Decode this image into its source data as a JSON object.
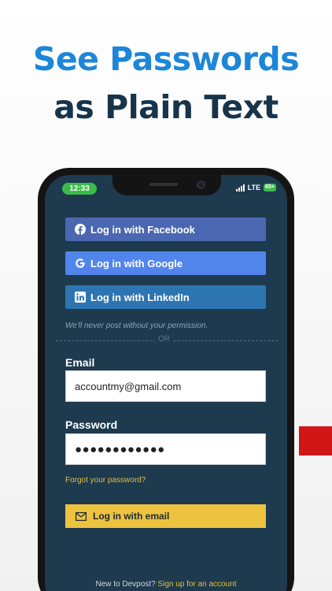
{
  "headline": {
    "line1": "See Passwords",
    "line2": "as Plain Text"
  },
  "status_bar": {
    "time": "12:33",
    "network": "LTE",
    "battery": "65+"
  },
  "social_buttons": [
    {
      "label": "Log in with Facebook",
      "icon": "facebook-icon",
      "color": "#4b67b1"
    },
    {
      "label": "Log in with Google",
      "icon": "google-icon",
      "color": "#5285ec"
    },
    {
      "label": "Log in with LinkedIn",
      "icon": "linkedin-icon",
      "color": "#2d75b1"
    }
  ],
  "disclaimer": "We'll never post without your permission.",
  "divider_text": "OR",
  "email": {
    "label": "Email",
    "value": "accountmy@gmail.com"
  },
  "password": {
    "label": "Password",
    "value": "●●●●●●●●●●●●"
  },
  "forgot_link": "Forgot your password?",
  "email_login_button": {
    "label": "Log in with email",
    "icon": "envelope-icon",
    "color": "#ecc23f"
  },
  "footer": {
    "text": "New to Devpost?",
    "link": "Sign up for an account"
  },
  "colors": {
    "headline_blue": "#1d86d9",
    "headline_dark": "#17344a",
    "screen_bg": "#1d3a4f",
    "accent_yellow": "#e5be3d",
    "red_bar": "#d01616"
  }
}
